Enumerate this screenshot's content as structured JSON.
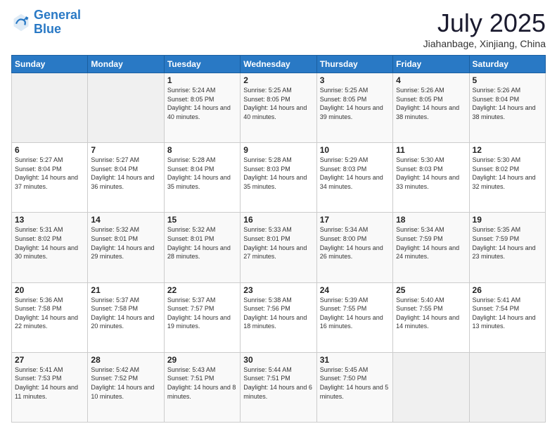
{
  "header": {
    "logo_general": "General",
    "logo_blue": "Blue",
    "month_title": "July 2025",
    "subtitle": "Jiahanbage, Xinjiang, China"
  },
  "weekdays": [
    "Sunday",
    "Monday",
    "Tuesday",
    "Wednesday",
    "Thursday",
    "Friday",
    "Saturday"
  ],
  "weeks": [
    [
      {
        "day": "",
        "sunrise": "",
        "sunset": "",
        "daylight": ""
      },
      {
        "day": "",
        "sunrise": "",
        "sunset": "",
        "daylight": ""
      },
      {
        "day": "1",
        "sunrise": "Sunrise: 5:24 AM",
        "sunset": "Sunset: 8:05 PM",
        "daylight": "Daylight: 14 hours and 40 minutes."
      },
      {
        "day": "2",
        "sunrise": "Sunrise: 5:25 AM",
        "sunset": "Sunset: 8:05 PM",
        "daylight": "Daylight: 14 hours and 40 minutes."
      },
      {
        "day": "3",
        "sunrise": "Sunrise: 5:25 AM",
        "sunset": "Sunset: 8:05 PM",
        "daylight": "Daylight: 14 hours and 39 minutes."
      },
      {
        "day": "4",
        "sunrise": "Sunrise: 5:26 AM",
        "sunset": "Sunset: 8:05 PM",
        "daylight": "Daylight: 14 hours and 38 minutes."
      },
      {
        "day": "5",
        "sunrise": "Sunrise: 5:26 AM",
        "sunset": "Sunset: 8:04 PM",
        "daylight": "Daylight: 14 hours and 38 minutes."
      }
    ],
    [
      {
        "day": "6",
        "sunrise": "Sunrise: 5:27 AM",
        "sunset": "Sunset: 8:04 PM",
        "daylight": "Daylight: 14 hours and 37 minutes."
      },
      {
        "day": "7",
        "sunrise": "Sunrise: 5:27 AM",
        "sunset": "Sunset: 8:04 PM",
        "daylight": "Daylight: 14 hours and 36 minutes."
      },
      {
        "day": "8",
        "sunrise": "Sunrise: 5:28 AM",
        "sunset": "Sunset: 8:04 PM",
        "daylight": "Daylight: 14 hours and 35 minutes."
      },
      {
        "day": "9",
        "sunrise": "Sunrise: 5:28 AM",
        "sunset": "Sunset: 8:03 PM",
        "daylight": "Daylight: 14 hours and 35 minutes."
      },
      {
        "day": "10",
        "sunrise": "Sunrise: 5:29 AM",
        "sunset": "Sunset: 8:03 PM",
        "daylight": "Daylight: 14 hours and 34 minutes."
      },
      {
        "day": "11",
        "sunrise": "Sunrise: 5:30 AM",
        "sunset": "Sunset: 8:03 PM",
        "daylight": "Daylight: 14 hours and 33 minutes."
      },
      {
        "day": "12",
        "sunrise": "Sunrise: 5:30 AM",
        "sunset": "Sunset: 8:02 PM",
        "daylight": "Daylight: 14 hours and 32 minutes."
      }
    ],
    [
      {
        "day": "13",
        "sunrise": "Sunrise: 5:31 AM",
        "sunset": "Sunset: 8:02 PM",
        "daylight": "Daylight: 14 hours and 30 minutes."
      },
      {
        "day": "14",
        "sunrise": "Sunrise: 5:32 AM",
        "sunset": "Sunset: 8:01 PM",
        "daylight": "Daylight: 14 hours and 29 minutes."
      },
      {
        "day": "15",
        "sunrise": "Sunrise: 5:32 AM",
        "sunset": "Sunset: 8:01 PM",
        "daylight": "Daylight: 14 hours and 28 minutes."
      },
      {
        "day": "16",
        "sunrise": "Sunrise: 5:33 AM",
        "sunset": "Sunset: 8:01 PM",
        "daylight": "Daylight: 14 hours and 27 minutes."
      },
      {
        "day": "17",
        "sunrise": "Sunrise: 5:34 AM",
        "sunset": "Sunset: 8:00 PM",
        "daylight": "Daylight: 14 hours and 26 minutes."
      },
      {
        "day": "18",
        "sunrise": "Sunrise: 5:34 AM",
        "sunset": "Sunset: 7:59 PM",
        "daylight": "Daylight: 14 hours and 24 minutes."
      },
      {
        "day": "19",
        "sunrise": "Sunrise: 5:35 AM",
        "sunset": "Sunset: 7:59 PM",
        "daylight": "Daylight: 14 hours and 23 minutes."
      }
    ],
    [
      {
        "day": "20",
        "sunrise": "Sunrise: 5:36 AM",
        "sunset": "Sunset: 7:58 PM",
        "daylight": "Daylight: 14 hours and 22 minutes."
      },
      {
        "day": "21",
        "sunrise": "Sunrise: 5:37 AM",
        "sunset": "Sunset: 7:58 PM",
        "daylight": "Daylight: 14 hours and 20 minutes."
      },
      {
        "day": "22",
        "sunrise": "Sunrise: 5:37 AM",
        "sunset": "Sunset: 7:57 PM",
        "daylight": "Daylight: 14 hours and 19 minutes."
      },
      {
        "day": "23",
        "sunrise": "Sunrise: 5:38 AM",
        "sunset": "Sunset: 7:56 PM",
        "daylight": "Daylight: 14 hours and 18 minutes."
      },
      {
        "day": "24",
        "sunrise": "Sunrise: 5:39 AM",
        "sunset": "Sunset: 7:55 PM",
        "daylight": "Daylight: 14 hours and 16 minutes."
      },
      {
        "day": "25",
        "sunrise": "Sunrise: 5:40 AM",
        "sunset": "Sunset: 7:55 PM",
        "daylight": "Daylight: 14 hours and 14 minutes."
      },
      {
        "day": "26",
        "sunrise": "Sunrise: 5:41 AM",
        "sunset": "Sunset: 7:54 PM",
        "daylight": "Daylight: 14 hours and 13 minutes."
      }
    ],
    [
      {
        "day": "27",
        "sunrise": "Sunrise: 5:41 AM",
        "sunset": "Sunset: 7:53 PM",
        "daylight": "Daylight: 14 hours and 11 minutes."
      },
      {
        "day": "28",
        "sunrise": "Sunrise: 5:42 AM",
        "sunset": "Sunset: 7:52 PM",
        "daylight": "Daylight: 14 hours and 10 minutes."
      },
      {
        "day": "29",
        "sunrise": "Sunrise: 5:43 AM",
        "sunset": "Sunset: 7:51 PM",
        "daylight": "Daylight: 14 hours and 8 minutes."
      },
      {
        "day": "30",
        "sunrise": "Sunrise: 5:44 AM",
        "sunset": "Sunset: 7:51 PM",
        "daylight": "Daylight: 14 hours and 6 minutes."
      },
      {
        "day": "31",
        "sunrise": "Sunrise: 5:45 AM",
        "sunset": "Sunset: 7:50 PM",
        "daylight": "Daylight: 14 hours and 5 minutes."
      },
      {
        "day": "",
        "sunrise": "",
        "sunset": "",
        "daylight": ""
      },
      {
        "day": "",
        "sunrise": "",
        "sunset": "",
        "daylight": ""
      }
    ]
  ]
}
